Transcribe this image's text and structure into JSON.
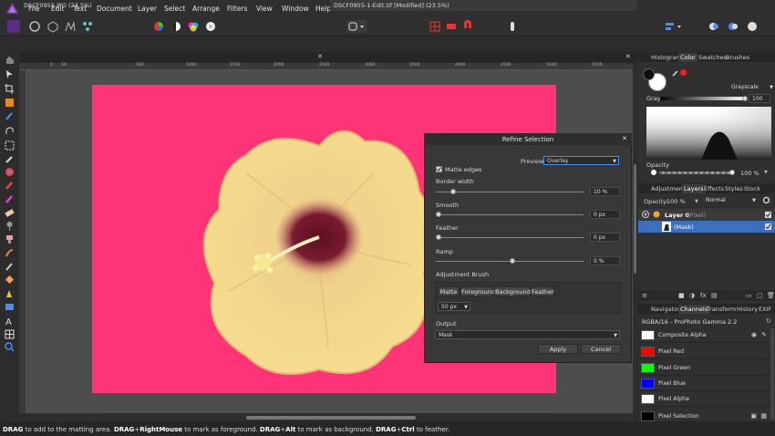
{
  "menu": [
    "File",
    "Edit",
    "Text",
    "Document",
    "Layer",
    "Select",
    "Arrange",
    "Filters",
    "View",
    "Window",
    "Help"
  ],
  "tabs": [
    {
      "label": "DSCF0955.JPG (23.5%)",
      "active": false
    },
    {
      "label": "DSCF0955-1-Edit.tif [Modified] (23.5%)",
      "active": true
    }
  ],
  "tab_close_glyph": "✕",
  "ruler_h": [
    "0",
    "50",
    "500",
    "1000",
    "1500",
    "2000",
    "2500",
    "3000",
    "3500",
    "4000",
    "4500",
    "5000",
    "5500"
  ],
  "dialog": {
    "title": "Refine Selection",
    "close": "✕",
    "preview_label": "Preview",
    "preview_value": "Overlay",
    "matte_edges": "Matte edges",
    "border_width_label": "Border width",
    "border_width_value": "10 %",
    "border_width_fraction": 0.1,
    "smooth_label": "Smooth",
    "smooth_value": "0 px",
    "feather_label": "Feather",
    "feather_value": "0 px",
    "ramp_label": "Ramp",
    "ramp_value": "0 %",
    "ramp_fraction": 0.5,
    "adjustment_brush_label": "Adjustment Brush",
    "brush_buttons": [
      "Matte",
      "Foreground",
      "Background",
      "Feather"
    ],
    "brush_size": "50 px",
    "output_label": "Output",
    "output_value": "Mask",
    "apply": "Apply",
    "cancel": "Cancel"
  },
  "panel_top": {
    "tabs": [
      "Histogram",
      "Color",
      "Swatches",
      "Brushes"
    ],
    "active": "Color",
    "mode": "Grayscale",
    "gray_label": "Gray:",
    "gray_value": "100",
    "opacity_label": "Opacity",
    "opacity_value": "100 %"
  },
  "panel_layers": {
    "tabs": [
      "Adjustment",
      "Layers",
      "Effects",
      "Styles",
      "Stock"
    ],
    "active": "Layers",
    "opacity_label": "Opacity:",
    "opacity_value": "100 %",
    "blend": "Normal",
    "layer_name": "Layer 0",
    "layer_type": "(Pixel)",
    "mask_name": "(Mask)"
  },
  "panel_channels": {
    "tabs": [
      "Navigator",
      "Channels",
      "Transform",
      "History",
      "EXIF"
    ],
    "active": "Channels",
    "profile": "RGBA/16 - ProPhoto Gamma 2.2",
    "channels": [
      {
        "name": "Composite Alpha",
        "color": "#ffffff"
      },
      {
        "name": "Pixel Red",
        "color": "#ff0000"
      },
      {
        "name": "Pixel Green",
        "color": "#00ff00"
      },
      {
        "name": "Pixel Blue",
        "color": "#0000ff"
      },
      {
        "name": "Pixel Alpha",
        "color": "#ffffff"
      },
      {
        "name": "Pixel Selection",
        "color": "#000000"
      }
    ]
  },
  "status": {
    "k1": "DRAG",
    "t1": " to add to the matting area. ",
    "k2": "DRAG",
    "t2": "+",
    "k3": "RightMouse",
    "t3": " to mark as foreground. ",
    "k4": "DRAG",
    "t4": "+",
    "k5": "Alt",
    "t5": " to mark as background. ",
    "k6": "DRAG",
    "t6": "+",
    "k7": "Ctrl",
    "t7": " to feather."
  },
  "colors": {
    "canvas_pink": "#fe3378",
    "accent_blue": "#3d6fbf"
  }
}
